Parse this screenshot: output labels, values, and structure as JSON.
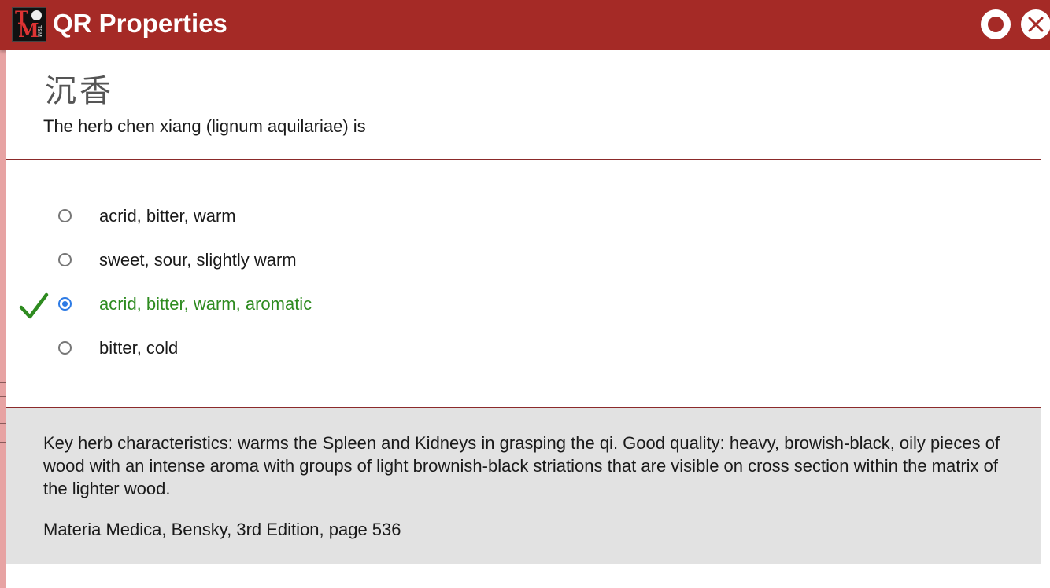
{
  "window": {
    "title": "QR Properties",
    "logo_text": "TSM"
  },
  "colors": {
    "header": "#a52a26",
    "correct": "#2e8b20",
    "selected_radio": "#2d7be5",
    "explanation_bg": "#e2e2e2"
  },
  "question": {
    "herb_characters": "沉香",
    "text": "The herb chen xiang (lignum aquilariae) is"
  },
  "options": [
    {
      "label": "acrid, bitter, warm",
      "selected": false,
      "correct": false
    },
    {
      "label": "sweet, sour, slightly warm",
      "selected": false,
      "correct": false
    },
    {
      "label": "acrid, bitter, warm, aromatic",
      "selected": true,
      "correct": true
    },
    {
      "label": "bitter, cold",
      "selected": false,
      "correct": false
    }
  ],
  "explanation": {
    "text": "Key herb characteristics: warms the Spleen and Kidneys in grasping the qi. Good quality: heavy, browish-black, oily pieces of wood with an intense aroma with groups of light brownish-black striations that are visible on cross section within the matrix of the lighter wood.",
    "reference": "Materia Medica, Bensky, 3rd Edition, page 536"
  },
  "icons": {
    "record": "record-icon",
    "close": "close-icon",
    "check": "checkmark-icon"
  }
}
